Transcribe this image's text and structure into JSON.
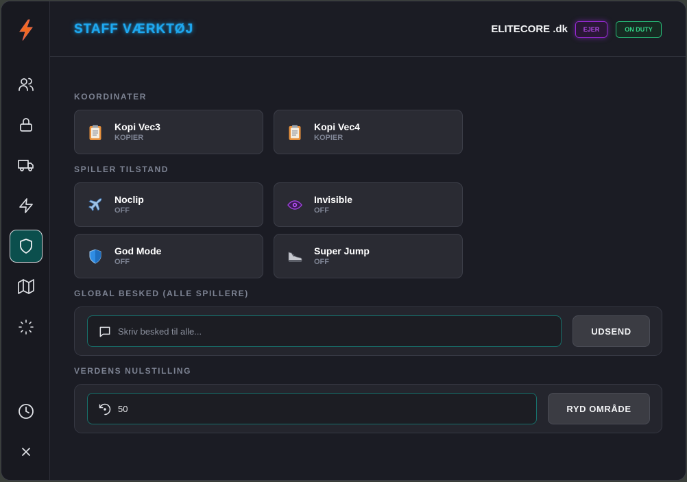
{
  "header": {
    "title": "STAFF VÆRKTØJ",
    "server": "ELITECORE .dk",
    "badge_owner": "EJER",
    "badge_duty": "ON DUTY"
  },
  "sidebar": {
    "items": [
      {
        "icon": "users-icon"
      },
      {
        "icon": "lock-icon"
      },
      {
        "icon": "truck-icon"
      },
      {
        "icon": "zap-icon"
      },
      {
        "icon": "shield-icon",
        "active": true
      },
      {
        "icon": "map-icon"
      },
      {
        "icon": "loader-icon"
      },
      {
        "icon": "clock-icon"
      },
      {
        "icon": "close-icon"
      }
    ]
  },
  "coordinates": {
    "label": "KOORDINATER",
    "cards": [
      {
        "name": "Kopi Vec3",
        "sub": "KOPIER",
        "icon": "clipboard-icon"
      },
      {
        "name": "Kopi Vec4",
        "sub": "KOPIER",
        "icon": "clipboard-icon"
      }
    ]
  },
  "player_state": {
    "label": "SPILLER TILSTAND",
    "cards": [
      {
        "name": "Noclip",
        "sub": "OFF",
        "icon": "airplane-icon"
      },
      {
        "name": "Invisible",
        "sub": "OFF",
        "icon": "eye-icon"
      },
      {
        "name": "God Mode",
        "sub": "OFF",
        "icon": "shield-icon"
      },
      {
        "name": "Super Jump",
        "sub": "OFF",
        "icon": "shoe-icon"
      }
    ]
  },
  "global_message": {
    "label": "GLOBAL BESKED (ALLE SPILLERE)",
    "placeholder": "Skriv besked til alle...",
    "value": "",
    "button": "UDSEND"
  },
  "world_reset": {
    "label": "VERDENS NULSTILLING",
    "value": "50",
    "button": "RYD OMRÅDE"
  },
  "colors": {
    "accent": "#1ea8f0",
    "active_nav": "#0b4f4d",
    "owner_badge": "#9b29d9",
    "duty_badge": "#27c07a"
  }
}
